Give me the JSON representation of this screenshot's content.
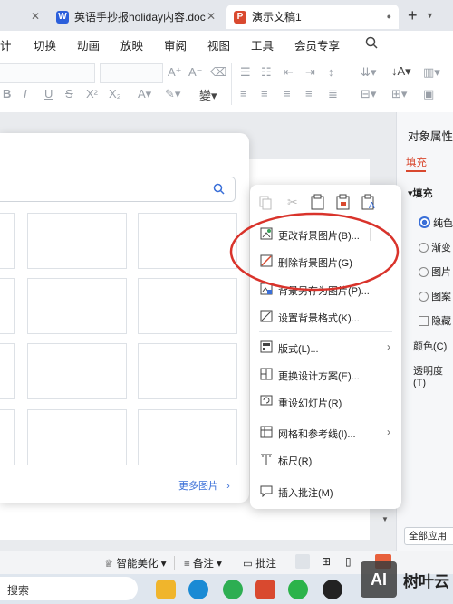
{
  "tabs": [
    {
      "label": "英语手抄报holiday内容.doc",
      "icon": "W",
      "icon_color": "#2b5fdb"
    },
    {
      "label": "演示文稿1",
      "icon": "P",
      "icon_color": "#d9492f"
    }
  ],
  "new_tab": "+",
  "menu": [
    "计",
    "切换",
    "动画",
    "放映",
    "审阅",
    "视图",
    "工具",
    "会员专享"
  ],
  "right_panel": {
    "title": "对象属性",
    "tab": "填充",
    "section": "填充",
    "options": [
      "纯色",
      "渐变",
      "图片",
      "图案",
      "隐藏"
    ],
    "color_label": "颜色(C)",
    "transparency_label": "透明度(T)",
    "apply_all": "全部应用"
  },
  "pic_panel": {
    "more_label": "更多图片"
  },
  "context_menu": {
    "items": [
      {
        "label": "更改背景图片(B)...",
        "submenu": true
      },
      {
        "label": "删除背景图片(G)",
        "submenu": false
      },
      {
        "label": "背景另存为图片(P)...",
        "submenu": false
      },
      {
        "label": "设置背景格式(K)...",
        "submenu": false
      },
      {
        "label": "版式(L)...",
        "submenu": true
      },
      {
        "label": "更换设计方案(E)...",
        "submenu": false
      },
      {
        "label": "重设幻灯片(R)",
        "submenu": false
      },
      {
        "label": "网格和参考线(I)...",
        "submenu": true
      },
      {
        "label": "标尺(R)",
        "submenu": false
      },
      {
        "label": "插入批注(M)",
        "submenu": false
      }
    ]
  },
  "status": {
    "smart": "智能美化",
    "notes": "备注",
    "comments": "批注"
  },
  "taskbar": {
    "search": "搜索"
  },
  "watermark": {
    "brand": "AI",
    "site": "树叶云"
  },
  "colors": {
    "accent": "#d9492f",
    "annotation_circle": "#d9332b",
    "link_blue": "#3a6fd8"
  }
}
